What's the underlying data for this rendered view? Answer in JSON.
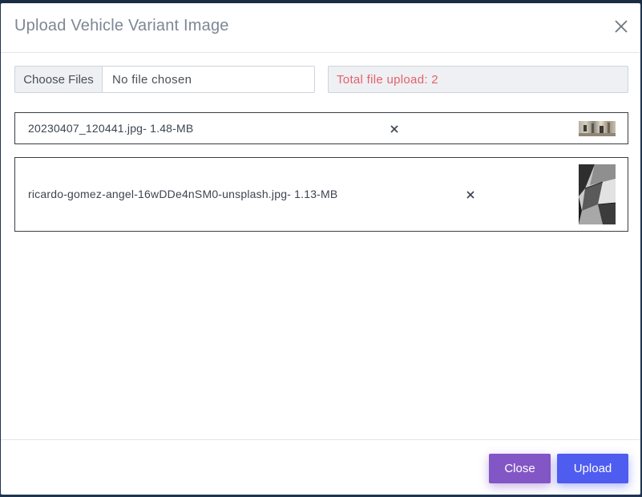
{
  "modal": {
    "title": "Upload Vehicle Variant Image"
  },
  "file_input": {
    "button_label": "Choose Files",
    "status_text": "No file chosen"
  },
  "total_upload": {
    "text": "Total file upload: 2"
  },
  "files": [
    {
      "name": "20230407_120441.jpg- 1.48-MB"
    },
    {
      "name": "ricardo-gomez-angel-16wDDe4nSM0-unsplash.jpg- 1.13-MB"
    }
  ],
  "footer": {
    "close_label": "Close",
    "upload_label": "Upload"
  },
  "colors": {
    "close_button": "#8356c6",
    "upload_button": "#4f5cf0",
    "total_text": "#e4606d"
  }
}
